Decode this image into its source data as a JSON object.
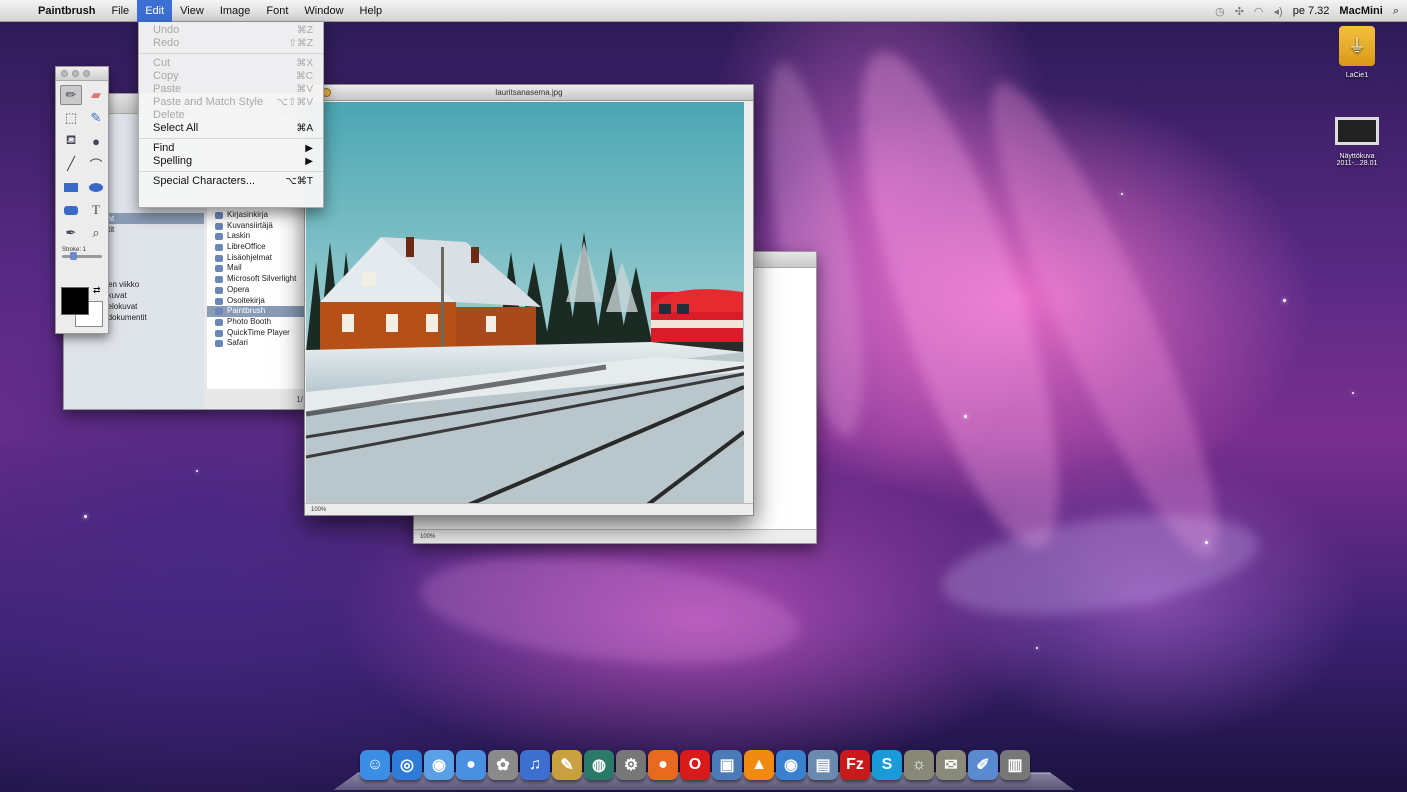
{
  "menubar": {
    "apple": "",
    "app_name": "Paintbrush",
    "items": [
      "File",
      "Edit",
      "View",
      "Image",
      "Font",
      "Window",
      "Help"
    ],
    "active_item": "Edit",
    "clock": "pe 7.32",
    "user": "MacMini"
  },
  "edit_menu": {
    "items": [
      {
        "label": "Undo",
        "shortcut": "⌘Z",
        "enabled": false
      },
      {
        "label": "Redo",
        "shortcut": "⇧⌘Z",
        "enabled": false
      },
      {
        "separator": true
      },
      {
        "label": "Cut",
        "shortcut": "⌘X",
        "enabled": false
      },
      {
        "label": "Copy",
        "shortcut": "⌘C",
        "enabled": false
      },
      {
        "label": "Paste",
        "shortcut": "⌘V",
        "enabled": false
      },
      {
        "label": "Paste and Match Style",
        "shortcut": "⌥⇧⌘V",
        "enabled": false
      },
      {
        "label": "Delete",
        "shortcut": "",
        "enabled": false
      },
      {
        "label": "Select All",
        "shortcut": "⌘A",
        "enabled": true
      },
      {
        "separator": true
      },
      {
        "label": "Find",
        "shortcut": "▶",
        "enabled": true
      },
      {
        "label": "Spelling",
        "shortcut": "▶",
        "enabled": true
      },
      {
        "separator": true
      },
      {
        "label": "Special Characters...",
        "shortcut": "⌥⌘T",
        "enabled": true
      }
    ]
  },
  "tool_palette": {
    "stroke_label": "Stroke: 1"
  },
  "finder": {
    "sidebar_rows": [
      "",
      "T",
      "ntosh",
      "k",
      "evy",
      "ke1",
      "",
      "pöytä",
      "182ee",
      "ohjelmat",
      "kumentit",
      "",
      "lataa",
      "haun",
      "h",
      "Edellinen viikko",
      "Kaikki kuvat",
      "Kaikki elokuvat",
      "Kaikki dokumentit"
    ],
    "selected_sidebar_row": 9,
    "apps": [
      "Kirjasinkirja",
      "Kuvansiirtäjä",
      "Laskin",
      "LibreOffice",
      "Lisäohjelmat",
      "Mail",
      "Microsoft Silverlight",
      "Opera",
      "Osoitekirja",
      "Paintbrush",
      "Photo Booth",
      "QuickTime Player",
      "Safari"
    ],
    "selected_app": 9,
    "status": "1/"
  },
  "photo_window": {
    "title": "lauritsanasema.jpg",
    "zoom": "100%"
  },
  "back_window": {
    "zoom": "100%"
  },
  "desktop_icons": [
    {
      "label": "LaCie1",
      "icon": "usb-drive-icon"
    },
    {
      "label": "Näyttökuva 2011-...28.01",
      "icon": "screenshot-file-icon"
    }
  ],
  "dock": {
    "apps": [
      {
        "icon": "finder-icon",
        "glyph": "☺",
        "color": "#3a8ee6"
      },
      {
        "icon": "safari-icon",
        "glyph": "◎",
        "color": "#2f7bd8"
      },
      {
        "icon": "app-store-icon",
        "glyph": "◉",
        "color": "#5aa0e8"
      },
      {
        "icon": "ichat-icon",
        "glyph": "●",
        "color": "#4a90e0"
      },
      {
        "icon": "photo-icon",
        "glyph": "✿",
        "color": "#8a8a8a"
      },
      {
        "icon": "itunes-icon",
        "glyph": "♫",
        "color": "#3c6fd0"
      },
      {
        "icon": "garageband-icon",
        "glyph": "✎",
        "color": "#c8a040"
      },
      {
        "icon": "time-machine-icon",
        "glyph": "◍",
        "color": "#2a7a6a"
      },
      {
        "icon": "system-preferences-icon",
        "glyph": "⚙",
        "color": "#777"
      },
      {
        "icon": "firefox-icon",
        "glyph": "●",
        "color": "#e86a20"
      },
      {
        "icon": "opera-icon",
        "glyph": "O",
        "color": "#d81a1a"
      },
      {
        "icon": "preview-icon",
        "glyph": "▣",
        "color": "#4a7ab8"
      },
      {
        "icon": "vlc-icon",
        "glyph": "▲",
        "color": "#f08a10"
      },
      {
        "icon": "network-icon",
        "glyph": "◉",
        "color": "#3a80d0"
      },
      {
        "icon": "file-icon",
        "glyph": "▤",
        "color": "#6a8ab0"
      },
      {
        "icon": "filezilla-icon",
        "glyph": "Fz",
        "color": "#c81a1a"
      },
      {
        "icon": "skype-icon",
        "glyph": "S",
        "color": "#1a9ad8"
      },
      {
        "icon": "cat-icon",
        "glyph": "☼",
        "color": "#887"
      },
      {
        "icon": "mail-icon",
        "glyph": "✉",
        "color": "#8a8a7a"
      },
      {
        "icon": "paintbrush-icon",
        "glyph": "✐",
        "color": "#5a8ad0"
      },
      {
        "icon": "trash-icon",
        "glyph": "▥",
        "color": "#777"
      }
    ]
  }
}
